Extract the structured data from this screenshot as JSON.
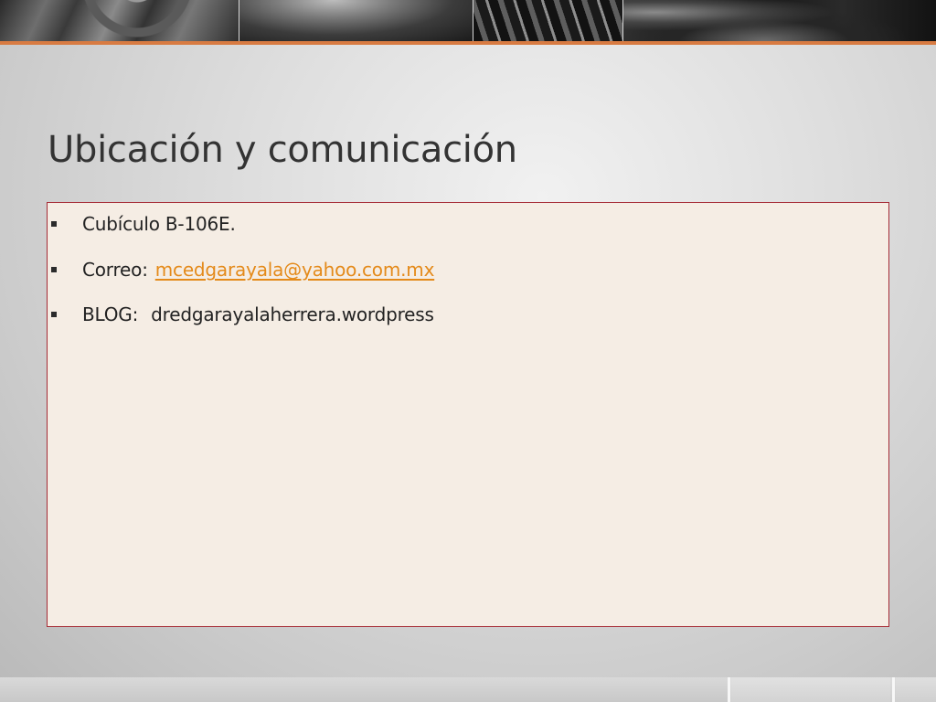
{
  "slide": {
    "title": "Ubicación y comunicación",
    "bullets": [
      {
        "text": "Cubículo B-106E."
      },
      {
        "label": "Correo:",
        "link_text": "mcedgarayala@yahoo.com.mx"
      },
      {
        "label": "BLOG:",
        "value": "dredgarayalaherrera.wordpress"
      }
    ]
  },
  "colors": {
    "accent_line": "#d87b42",
    "box_border": "#a52b35",
    "box_fill": "#f5ede4",
    "link": "#e48a1a",
    "title_text": "#333333"
  },
  "icons": {
    "bullet": "square-bullet-icon"
  }
}
